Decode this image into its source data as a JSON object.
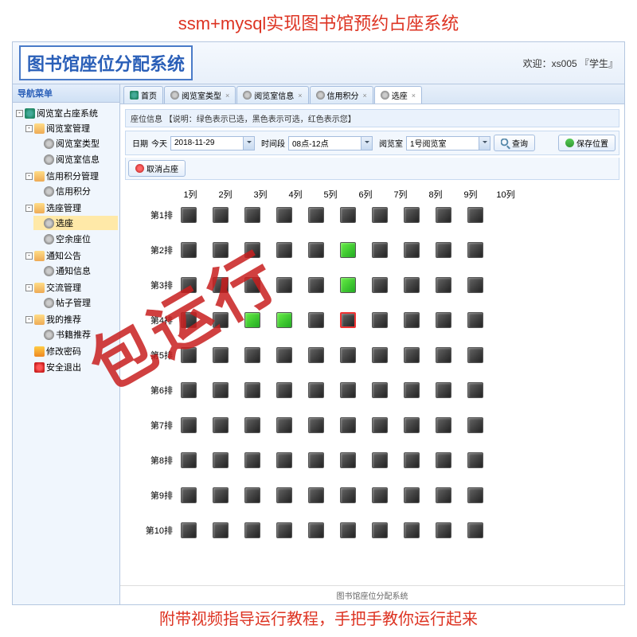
{
  "banners": {
    "top": "ssm+mysql实现图书馆预约占座系统",
    "bottom": "附带视频指导运行教程，手把手教你运行起来",
    "watermark": "包运行"
  },
  "header": {
    "logo": "图书馆座位分配系统",
    "welcome": "欢迎：xs005 『学生』"
  },
  "sidebar": {
    "title": "导航菜单",
    "root": "阅览室占座系统",
    "groups": [
      {
        "label": "阅览室管理",
        "items": [
          "阅览室类型",
          "阅览室信息"
        ]
      },
      {
        "label": "信用积分管理",
        "items": [
          "信用积分"
        ]
      },
      {
        "label": "选座管理",
        "items": [
          "选座",
          "空余座位"
        ],
        "selected": 0
      },
      {
        "label": "通知公告",
        "items": [
          "通知信息"
        ]
      },
      {
        "label": "交流管理",
        "items": [
          "帖子管理"
        ]
      },
      {
        "label": "我的推荐",
        "items": [
          "书籍推荐"
        ]
      }
    ],
    "extras": [
      {
        "label": "修改密码",
        "icon": "key"
      },
      {
        "label": "安全退出",
        "icon": "exit"
      }
    ]
  },
  "tabs": [
    {
      "label": "首页",
      "icon": "home",
      "closable": false
    },
    {
      "label": "阅览室类型",
      "icon": "gear",
      "closable": true
    },
    {
      "label": "阅览室信息",
      "icon": "gear",
      "closable": true
    },
    {
      "label": "信用积分",
      "icon": "gear",
      "closable": true
    },
    {
      "label": "选座",
      "icon": "gear",
      "closable": true,
      "active": true
    }
  ],
  "info": {
    "prefix": "座位信息 ",
    "legend": "【说明：绿色表示已选，黑色表示可选，红色表示您】"
  },
  "filters": {
    "date_label": "日期",
    "date_prefix": "今天",
    "date_value": "2018-11-29",
    "time_label": "时间段",
    "time_value": "08点-12点",
    "room_label": "阅览室",
    "room_value": "1号阅览室",
    "query": "查询",
    "save": "保存位置",
    "cancel": "取消占座"
  },
  "grid": {
    "cols": [
      "1列",
      "2列",
      "3列",
      "4列",
      "5列",
      "6列",
      "7列",
      "8列",
      "9列",
      "10列"
    ],
    "rows": [
      "第1排",
      "第2排",
      "第3排",
      "第4排",
      "第5排",
      "第6排",
      "第7排",
      "第8排",
      "第9排",
      "第10排"
    ],
    "special": {
      "1-5": "green",
      "2-5": "green",
      "3-2": "green",
      "3-3": "green",
      "3-5": "red"
    }
  },
  "footer": "图书馆座位分配系统"
}
